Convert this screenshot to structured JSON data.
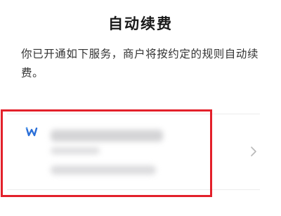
{
  "page": {
    "title": "自动续费",
    "description": "你已开通如下服务，商户将按约定的规则自动续费。"
  },
  "services": [
    {
      "logo_icon": "merchant-w-logo-icon",
      "name_obscured": true,
      "chevron_icon": "chevron-right-icon"
    }
  ],
  "colors": {
    "highlight": "#e3202a",
    "logo": "#2a6fd8",
    "chevron": "#b8b8b8"
  }
}
